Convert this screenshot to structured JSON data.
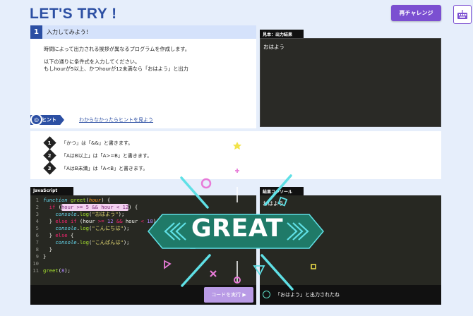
{
  "header": {
    "title": "LET'S TRY !",
    "retry_label": "再チャレンジ",
    "keyboard_icon": "keyboard-icon"
  },
  "step": {
    "number": "1",
    "title": "入力してみよう!",
    "lines": [
      "時間によって出力される挨拶が異なるプログラムを作成します。",
      "以下の通りに条件式を入力してください。",
      "もしhourが5以上、かつhourが12未満なら「おはよう」と出力"
    ],
    "hint_badge": "ヒント",
    "hint_link": "わからなかったらヒントを見よう"
  },
  "sample": {
    "label": "見本：出力結果",
    "output": "おはよう"
  },
  "hints": [
    {
      "num": "1",
      "text": "「かつ」は「&&」と書きます。"
    },
    {
      "num": "2",
      "text": "「AはB以上」は「A>=B」と書きます。"
    },
    {
      "num": "3",
      "text": "「AはB未満」は「A<B」と書きます。"
    }
  ],
  "editor": {
    "label": "JavaScript",
    "run_label": "コードを実行 ▶",
    "line_numbers": [
      "1",
      "2",
      "3",
      "4",
      "5",
      "6",
      "7",
      "8",
      "9",
      "10",
      "11"
    ]
  },
  "console": {
    "label": "結果コンソール",
    "output": "おはよう",
    "check_text": "「おはよう」と出力されたね"
  },
  "overlay": {
    "great": "GREAT"
  },
  "colors": {
    "accent": "#2c4fa3",
    "purple": "#7b4fd1",
    "great_banner": "#1f7a68",
    "cyan": "#5fe0e6",
    "pink": "#e87bd8"
  }
}
